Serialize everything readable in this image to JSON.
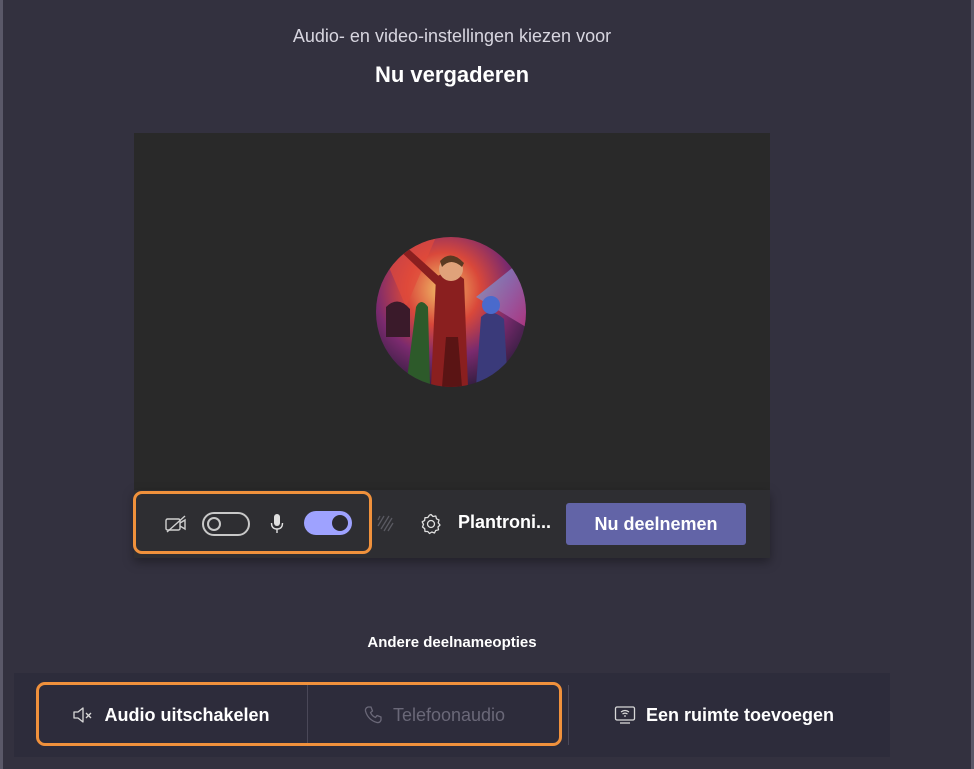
{
  "header": {
    "subtitle": "Audio- en video-instellingen kiezen voor",
    "title": "Nu vergaderen"
  },
  "preview": {
    "avatar_icon": "profile-picture"
  },
  "controls": {
    "camera_icon": "camera-off-icon",
    "camera_toggle_on": false,
    "mic_icon": "microphone-icon",
    "mic_toggle_on": true,
    "background_icon": "background-blur-icon",
    "settings_icon": "gear-icon",
    "device_label": "Plantroni...",
    "join_label": "Nu deelnemen"
  },
  "other_options": {
    "heading": "Andere deelnameopties",
    "items": [
      {
        "label": "Audio uitschakelen",
        "icon": "speaker-off-icon",
        "enabled": true
      },
      {
        "label": "Telefoonaudio",
        "icon": "phone-icon",
        "enabled": false
      },
      {
        "label": "Een ruimte toevoegen",
        "icon": "room-cast-icon",
        "enabled": true
      }
    ]
  },
  "colors": {
    "background": "#33313f",
    "accent": "#6264a7",
    "toggle_on": "#9ea2ff",
    "highlight": "#f0913c"
  }
}
